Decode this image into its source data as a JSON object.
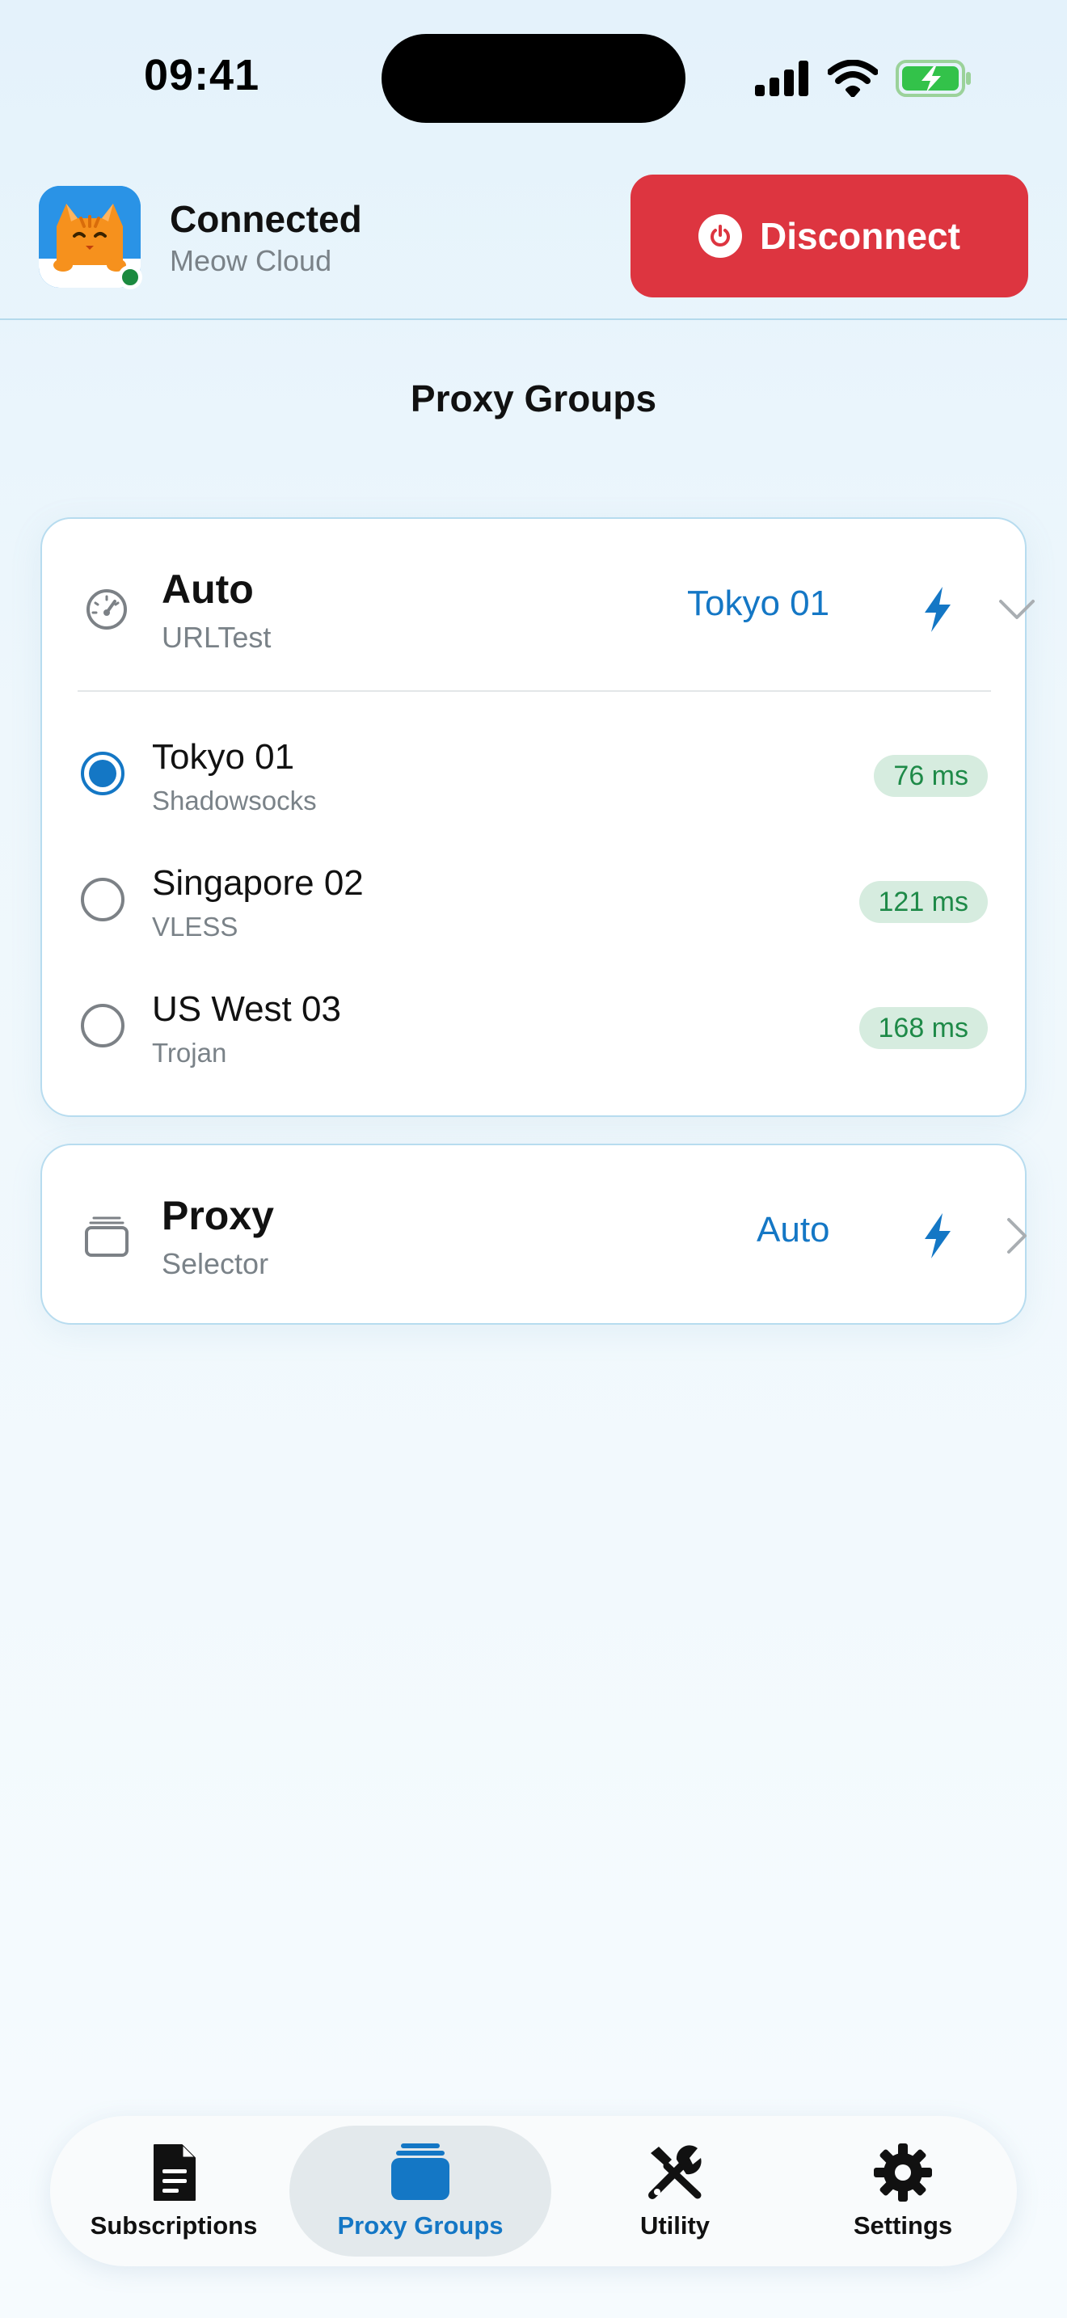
{
  "status_bar": {
    "time": "09:41"
  },
  "header": {
    "connection_status": "Connected",
    "profile_name": "Meow Cloud",
    "disconnect_label": "Disconnect"
  },
  "page": {
    "title": "Proxy Groups"
  },
  "groups": [
    {
      "name": "Auto",
      "type": "URLTest",
      "selected": "Tokyo 01",
      "expanded": true,
      "icon": "gauge-icon",
      "nodes": [
        {
          "name": "Tokyo 01",
          "protocol": "Shadowsocks",
          "latency": "76 ms",
          "selected": true
        },
        {
          "name": "Singapore 02",
          "protocol": "VLESS",
          "latency": "121 ms",
          "selected": false
        },
        {
          "name": "US West 03",
          "protocol": "Trojan",
          "latency": "168 ms",
          "selected": false
        }
      ]
    },
    {
      "name": "Proxy",
      "type": "Selector",
      "selected": "Auto",
      "expanded": false,
      "icon": "stack-icon"
    }
  ],
  "tabs": [
    {
      "label": "Subscriptions",
      "icon": "document-icon",
      "active": false
    },
    {
      "label": "Proxy Groups",
      "icon": "stack-icon",
      "active": true
    },
    {
      "label": "Utility",
      "icon": "tools-icon",
      "active": false
    },
    {
      "label": "Settings",
      "icon": "gear-icon",
      "active": false
    }
  ],
  "colors": {
    "accent": "#1477c5",
    "danger": "#dd3540",
    "latency_good": "#1e8a48",
    "online": "#1b8a3f"
  }
}
